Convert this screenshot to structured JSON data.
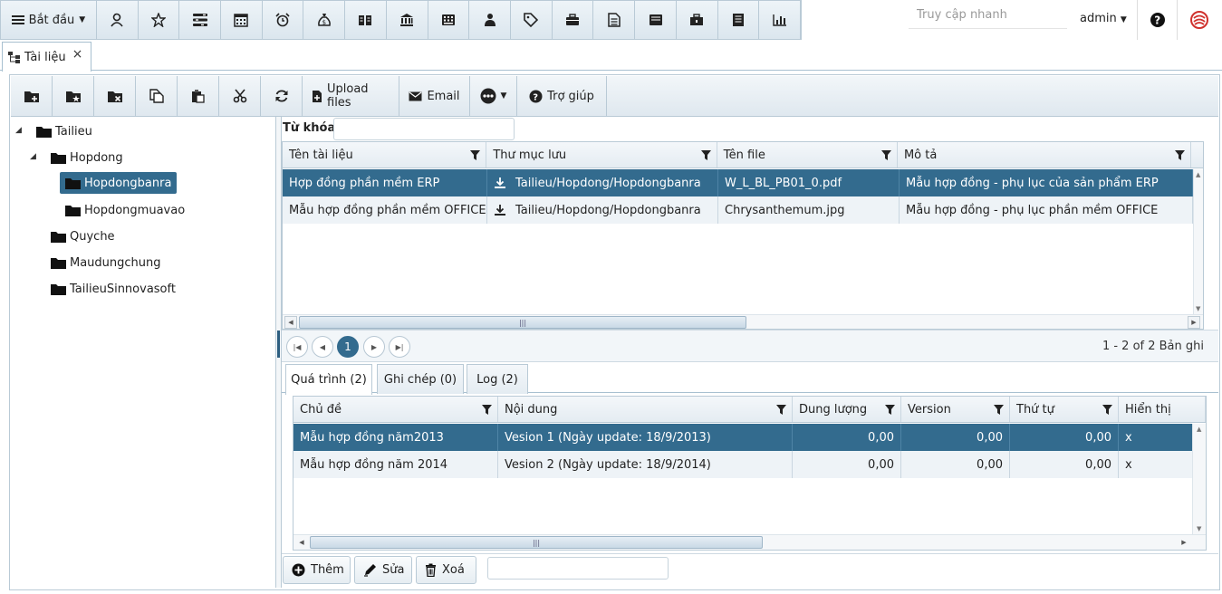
{
  "topbar": {
    "start_label": "Bắt đầu",
    "icons": [
      "user-icon",
      "star-icon",
      "list-icon",
      "calendar-icon",
      "alarm-icon",
      "money-bag-icon",
      "book-icon",
      "bank-icon",
      "calculator-icon",
      "person-icon",
      "tag-icon",
      "briefcase-icon",
      "document-icon",
      "inbox-icon",
      "toolbox-icon",
      "notebook-icon",
      "chart-icon"
    ],
    "quick_access_placeholder": "Truy cập nhanh",
    "user": "admin"
  },
  "tab": {
    "label": "Tài liệu",
    "close": "×"
  },
  "actions": {
    "icon_buttons": [
      "new-folder-icon",
      "folder-star-icon",
      "delete-folder-icon",
      "copy-icon",
      "paste-icon",
      "cut-icon",
      "refresh-icon"
    ],
    "upload_label": "Upload files",
    "email_label": "Email",
    "help_label": "Trợ giúp"
  },
  "tree": {
    "nodes": [
      {
        "label": "Tailieu"
      },
      {
        "label": "Hopdong"
      },
      {
        "label": "Hopdongbanra"
      },
      {
        "label": "Hopdongmuavao"
      },
      {
        "label": "Quyche"
      },
      {
        "label": "Maudungchung"
      },
      {
        "label": "TailieuSinnovasoft"
      }
    ]
  },
  "search": {
    "label": "Từ khóa",
    "value": ""
  },
  "docs_grid": {
    "columns": [
      "Tên tài liệu",
      "Thư mục lưu",
      "Tên file",
      "Mô tả"
    ],
    "rows": [
      {
        "name": "Hợp đồng phần mềm ERP",
        "folder": "Tailieu/Hopdong/Hopdongbanra",
        "file": "W_L_BL_PB01_0.pdf",
        "desc": "Mẫu hợp đồng - phụ lục của sản phẩm ERP"
      },
      {
        "name": "Mẫu hợp đồng phần mềm OFFICE",
        "folder": "Tailieu/Hopdong/Hopdongbanra",
        "file": "Chrysanthemum.jpg",
        "desc": "Mẫu hợp đồng - phụ lục phần mềm OFFICE"
      }
    ]
  },
  "pager": {
    "current_page": "1",
    "info": "1 - 2 of 2 Bản ghi"
  },
  "subtabs": [
    "Quá trình (2)",
    "Ghi chép (0)",
    "Log (2)"
  ],
  "history_grid": {
    "columns": [
      "Chủ đề",
      "Nội dung",
      "Dung lượng",
      "Version",
      "Thứ tự",
      "Hiển thị"
    ],
    "rows": [
      {
        "topic": "Mẫu hợp đồng năm2013",
        "content": "Vesion 1 (Ngày update: 18/9/2013)",
        "size": "0,00",
        "version": "0,00",
        "order": "0,00",
        "show": "x"
      },
      {
        "topic": "Mẫu hợp đồng năm 2014",
        "content": "Vesion 2 (Ngày update: 18/9/2014)",
        "size": "0,00",
        "version": "0,00",
        "order": "0,00",
        "show": "x"
      }
    ]
  },
  "bottom_actions": {
    "add": "Thêm",
    "edit": "Sửa",
    "delete": "Xoá"
  },
  "colors": {
    "accent": "#336b8e",
    "border": "#b9cad6",
    "logo_red": "#d0312d"
  }
}
